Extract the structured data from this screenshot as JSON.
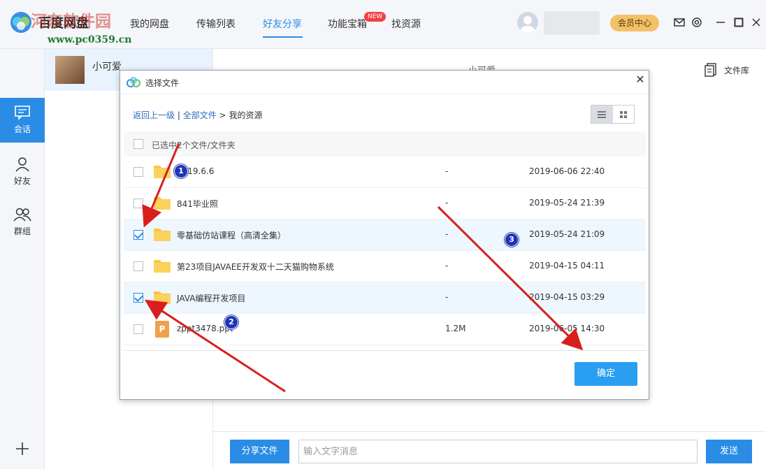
{
  "app": {
    "title": "百度网盘",
    "nav": [
      "我的网盘",
      "传输列表",
      "好友分享",
      "功能宝箱",
      "找资源"
    ],
    "active_nav": "好友分享",
    "new_badge": "NEW",
    "vip_label": "会员中心"
  },
  "watermark": {
    "line1": "河东软件园",
    "line2": "www.pc0359.cn"
  },
  "leftnav": [
    {
      "label": "会话",
      "icon": "chat-icon",
      "active": true
    },
    {
      "label": "好友",
      "icon": "user-icon",
      "active": false
    },
    {
      "label": "群组",
      "icon": "group-icon",
      "active": false
    }
  ],
  "contact": {
    "name": "小可爱"
  },
  "chat": {
    "header_name": "小可爱",
    "file_library": "文件库",
    "share_button": "分享文件",
    "input_placeholder": "输入文字消息",
    "send_button": "发送"
  },
  "dialog": {
    "title": "选择文件",
    "crumb_back": "返回上一级",
    "crumb_all": "全部文件",
    "crumb_sep": ">",
    "crumb_current": "我的资源",
    "selected_text": "已选中2个文件/文件夹",
    "ok_button": "确定",
    "files": [
      {
        "name": "2019.6.6",
        "size": "-",
        "date": "2019-06-06 22:40",
        "type": "folder",
        "checked": false
      },
      {
        "name": "841毕业照",
        "size": "-",
        "date": "2019-05-24 21:39",
        "type": "folder",
        "checked": false
      },
      {
        "name": "零基础仿站课程（高清全集）",
        "size": "-",
        "date": "2019-05-24 21:09",
        "type": "folder",
        "checked": true
      },
      {
        "name": "第23项目JAVAEE开发双十二天猫购物系统",
        "size": "-",
        "date": "2019-04-15 04:11",
        "type": "folder",
        "checked": false
      },
      {
        "name": "JAVA编程开发项目",
        "size": "-",
        "date": "2019-04-15 03:29",
        "type": "folder",
        "checked": true
      },
      {
        "name": "zppt3478.ppt",
        "size": "1.2M",
        "date": "2019-06-05 14:30",
        "type": "ppt",
        "checked": false
      }
    ]
  },
  "annotations": [
    "1",
    "2",
    "3"
  ],
  "colors": {
    "accent": "#2a8ce5",
    "arrow": "#d91e1e",
    "marker": "#1d35b5"
  }
}
